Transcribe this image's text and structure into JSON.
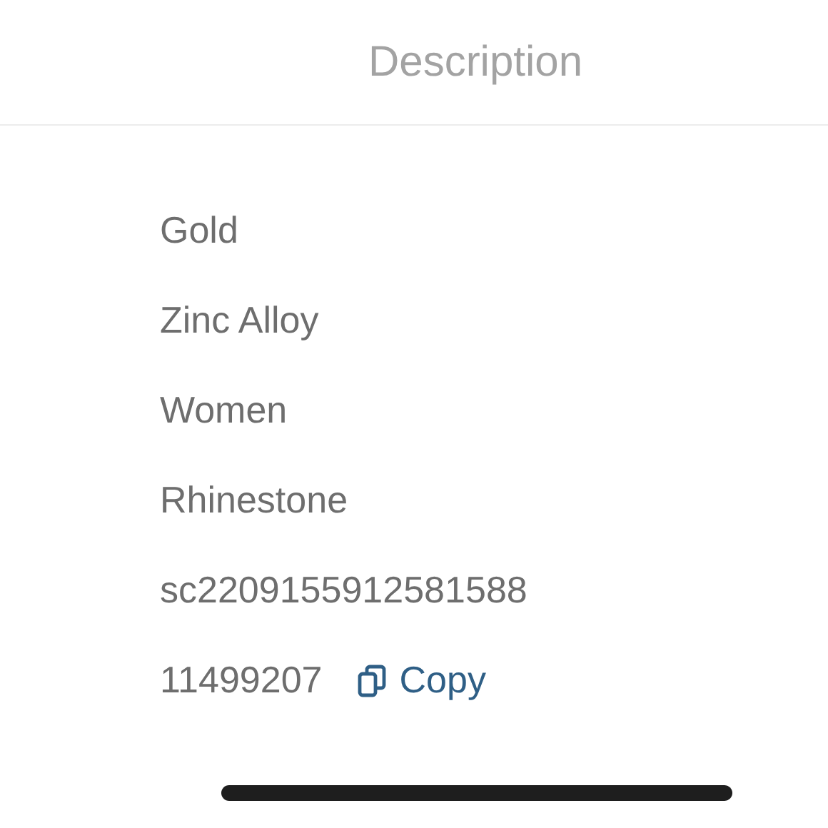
{
  "header": {
    "title": "Description"
  },
  "rows": [
    {
      "kind": "text",
      "value": "Gold"
    },
    {
      "kind": "text",
      "value": "Zinc Alloy"
    },
    {
      "kind": "text",
      "value": "Women"
    },
    {
      "kind": "text",
      "value": "Rhinestone"
    },
    {
      "kind": "text",
      "value": "sc2209155912581588"
    },
    {
      "kind": "copy",
      "value": "11499207",
      "action": "Copy"
    }
  ]
}
